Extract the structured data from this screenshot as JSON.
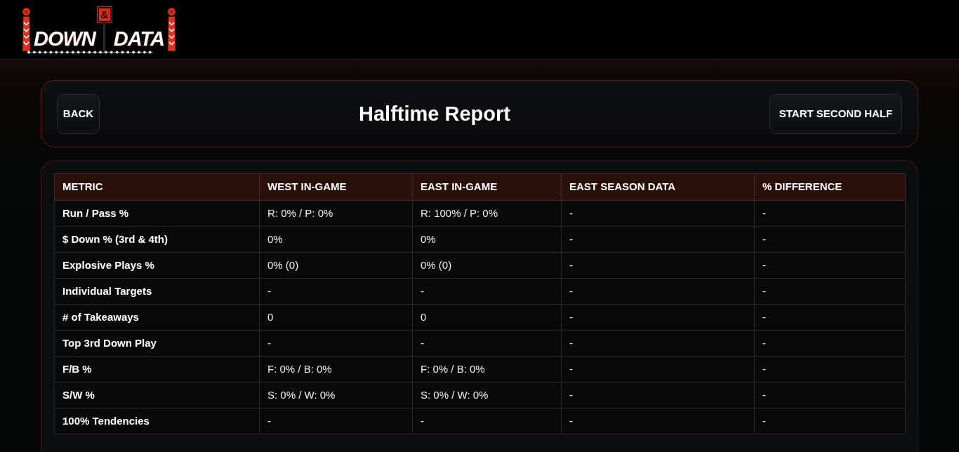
{
  "logo": {
    "left_word": "DOWN",
    "badge": "&",
    "right_word": "DATA"
  },
  "header": {
    "back_button": "BACK",
    "title": "Halftime Report",
    "action_button": "START SECOND HALF"
  },
  "table": {
    "columns": [
      "METRIC",
      "WEST IN-GAME",
      "EAST IN-GAME",
      "EAST SEASON DATA",
      "% DIFFERENCE"
    ],
    "rows": [
      [
        "Run / Pass %",
        "R: 0% / P: 0%",
        "R: 100% / P: 0%",
        "-",
        "-"
      ],
      [
        "$ Down % (3rd & 4th)",
        "0%",
        "0%",
        "-",
        "-"
      ],
      [
        "Explosive Plays %",
        "0% (0)",
        "0% (0)",
        "-",
        "-"
      ],
      [
        "Individual Targets",
        "-",
        "-",
        "-",
        "-"
      ],
      [
        "# of Takeaways",
        "0",
        "0",
        "-",
        "-"
      ],
      [
        "Top 3rd Down Play",
        "-",
        "-",
        "-",
        "-"
      ],
      [
        "F/B %",
        "F: 0% / B: 0%",
        "F: 0% / B: 0%",
        "-",
        "-"
      ],
      [
        "S/W %",
        "S: 0% / W: 0%",
        "S: 0% / W: 0%",
        "-",
        "-"
      ],
      [
        "100% Tendencies",
        "-",
        "-",
        "-",
        "-"
      ]
    ]
  }
}
